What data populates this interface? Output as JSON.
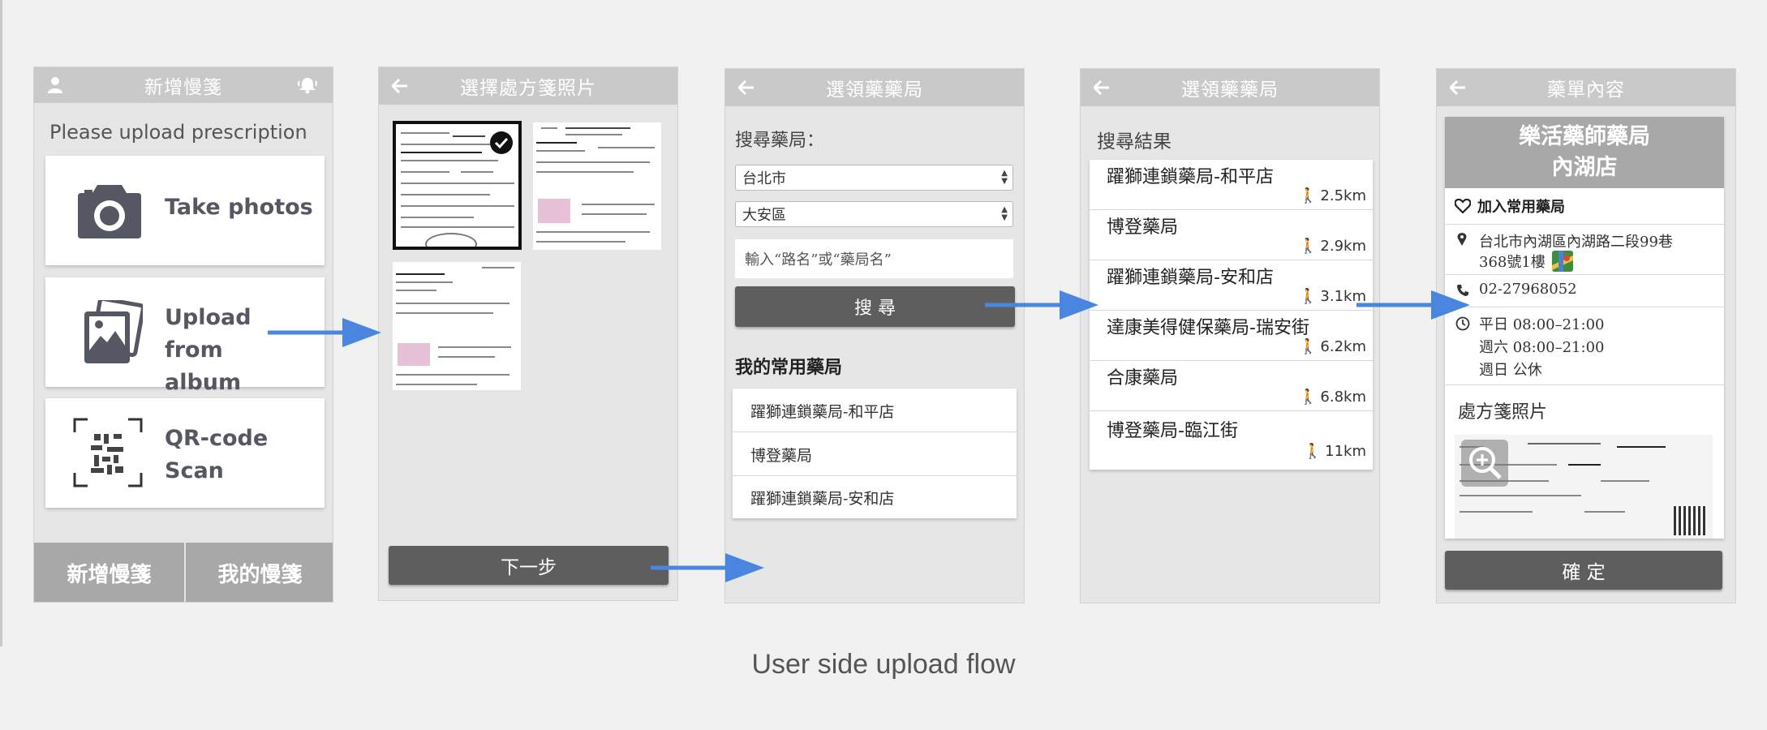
{
  "caption": "User side upload flow",
  "screen1": {
    "title": "新增慢箋",
    "header_icons": [
      "user-icon",
      "bell-icon"
    ],
    "instruction": "Please upload prescription",
    "options": [
      {
        "label": "Take photos",
        "icon": "camera-icon"
      },
      {
        "label": "Upload from album",
        "icon": "photo-album-icon"
      },
      {
        "label": "QR-code Scan",
        "icon": "qr-code-icon"
      }
    ],
    "tabs": [
      "新增慢箋",
      "我的慢箋"
    ]
  },
  "screen2": {
    "title": "選擇處方箋照片",
    "next_label": "下一步"
  },
  "screen3": {
    "title": "選領藥藥局",
    "search_label": "搜尋藥局：",
    "city": "台北市",
    "district": "大安區",
    "search_placeholder": "輸入“路名”或“藥局名”",
    "search_button": "搜 尋",
    "favorites_heading": "我的常用藥局",
    "favorites": [
      "躍獅連鎖藥局-和平店",
      "博登藥局",
      "躍獅連鎖藥局-安和店"
    ]
  },
  "screen4": {
    "title": "選領藥藥局",
    "results_heading": "搜尋結果",
    "results": [
      {
        "name": "躍獅連鎖藥局-和平店",
        "distance": "2.5km"
      },
      {
        "name": "博登藥局",
        "distance": "2.9km"
      },
      {
        "name": "躍獅連鎖藥局-安和店",
        "distance": "3.1km"
      },
      {
        "name": "達康美得健保藥局-瑞安街",
        "distance": "6.2km"
      },
      {
        "name": "合康藥局",
        "distance": "6.8km"
      },
      {
        "name": "博登藥局-臨江街",
        "distance": "11km"
      }
    ]
  },
  "screen5": {
    "title": "藥單內容",
    "pharmacy_name_line1": "樂活藥師藥局",
    "pharmacy_name_line2": "內湖店",
    "add_favorite": "加入常用藥局",
    "address_line1": "台北市內湖區內湖路二段99巷",
    "address_line2": "368號1樓",
    "phone": "02-27968052",
    "hours": [
      "平日 08:00–21:00",
      "週六 08:00–21:00",
      "週日 公休"
    ],
    "photo_heading": "處方箋照片",
    "confirm_label": "確 定"
  },
  "colors": {
    "arrow": "#4a86e0",
    "titlebar": "#c9c9c9",
    "button_dark": "#5e5e5e",
    "panel_bg": "#e6e6e6"
  }
}
